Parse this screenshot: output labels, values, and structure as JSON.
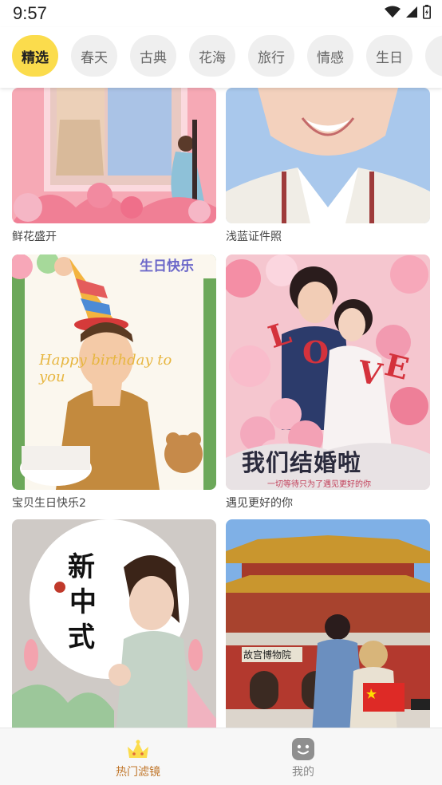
{
  "status_bar": {
    "time": "9:57"
  },
  "categories": [
    {
      "label": "精选",
      "active": true
    },
    {
      "label": "春天"
    },
    {
      "label": "古典"
    },
    {
      "label": "花海"
    },
    {
      "label": "旅行"
    },
    {
      "label": "情感"
    },
    {
      "label": "生日"
    }
  ],
  "cards": [
    {
      "caption": "鲜花盛开"
    },
    {
      "caption": "浅蓝证件照"
    },
    {
      "caption": "宝贝生日快乐2"
    },
    {
      "caption": "遇见更好的你"
    },
    {
      "caption": ""
    },
    {
      "caption": ""
    }
  ],
  "thumb_text": {
    "birthday_banner": "生日快乐",
    "happy_text": "Happy birthday to you",
    "love_letters": [
      "L",
      "O",
      "V",
      "E"
    ],
    "wedding_title": "我们结婚啦",
    "wedding_sub": "一切等待只为了遇见更好的你",
    "xinzhongshi": [
      "新",
      "中",
      "式"
    ],
    "palace_sign": "故宫博物院"
  },
  "bottom_nav": {
    "items": [
      {
        "label": "热门滤镜",
        "icon": "crown-icon",
        "active": true
      },
      {
        "label": "我的",
        "icon": "smiley-icon",
        "active": false
      }
    ]
  },
  "colors": {
    "accent": "#fbdc4c",
    "active_label": "#c0762a",
    "inactive_label": "#888888"
  }
}
